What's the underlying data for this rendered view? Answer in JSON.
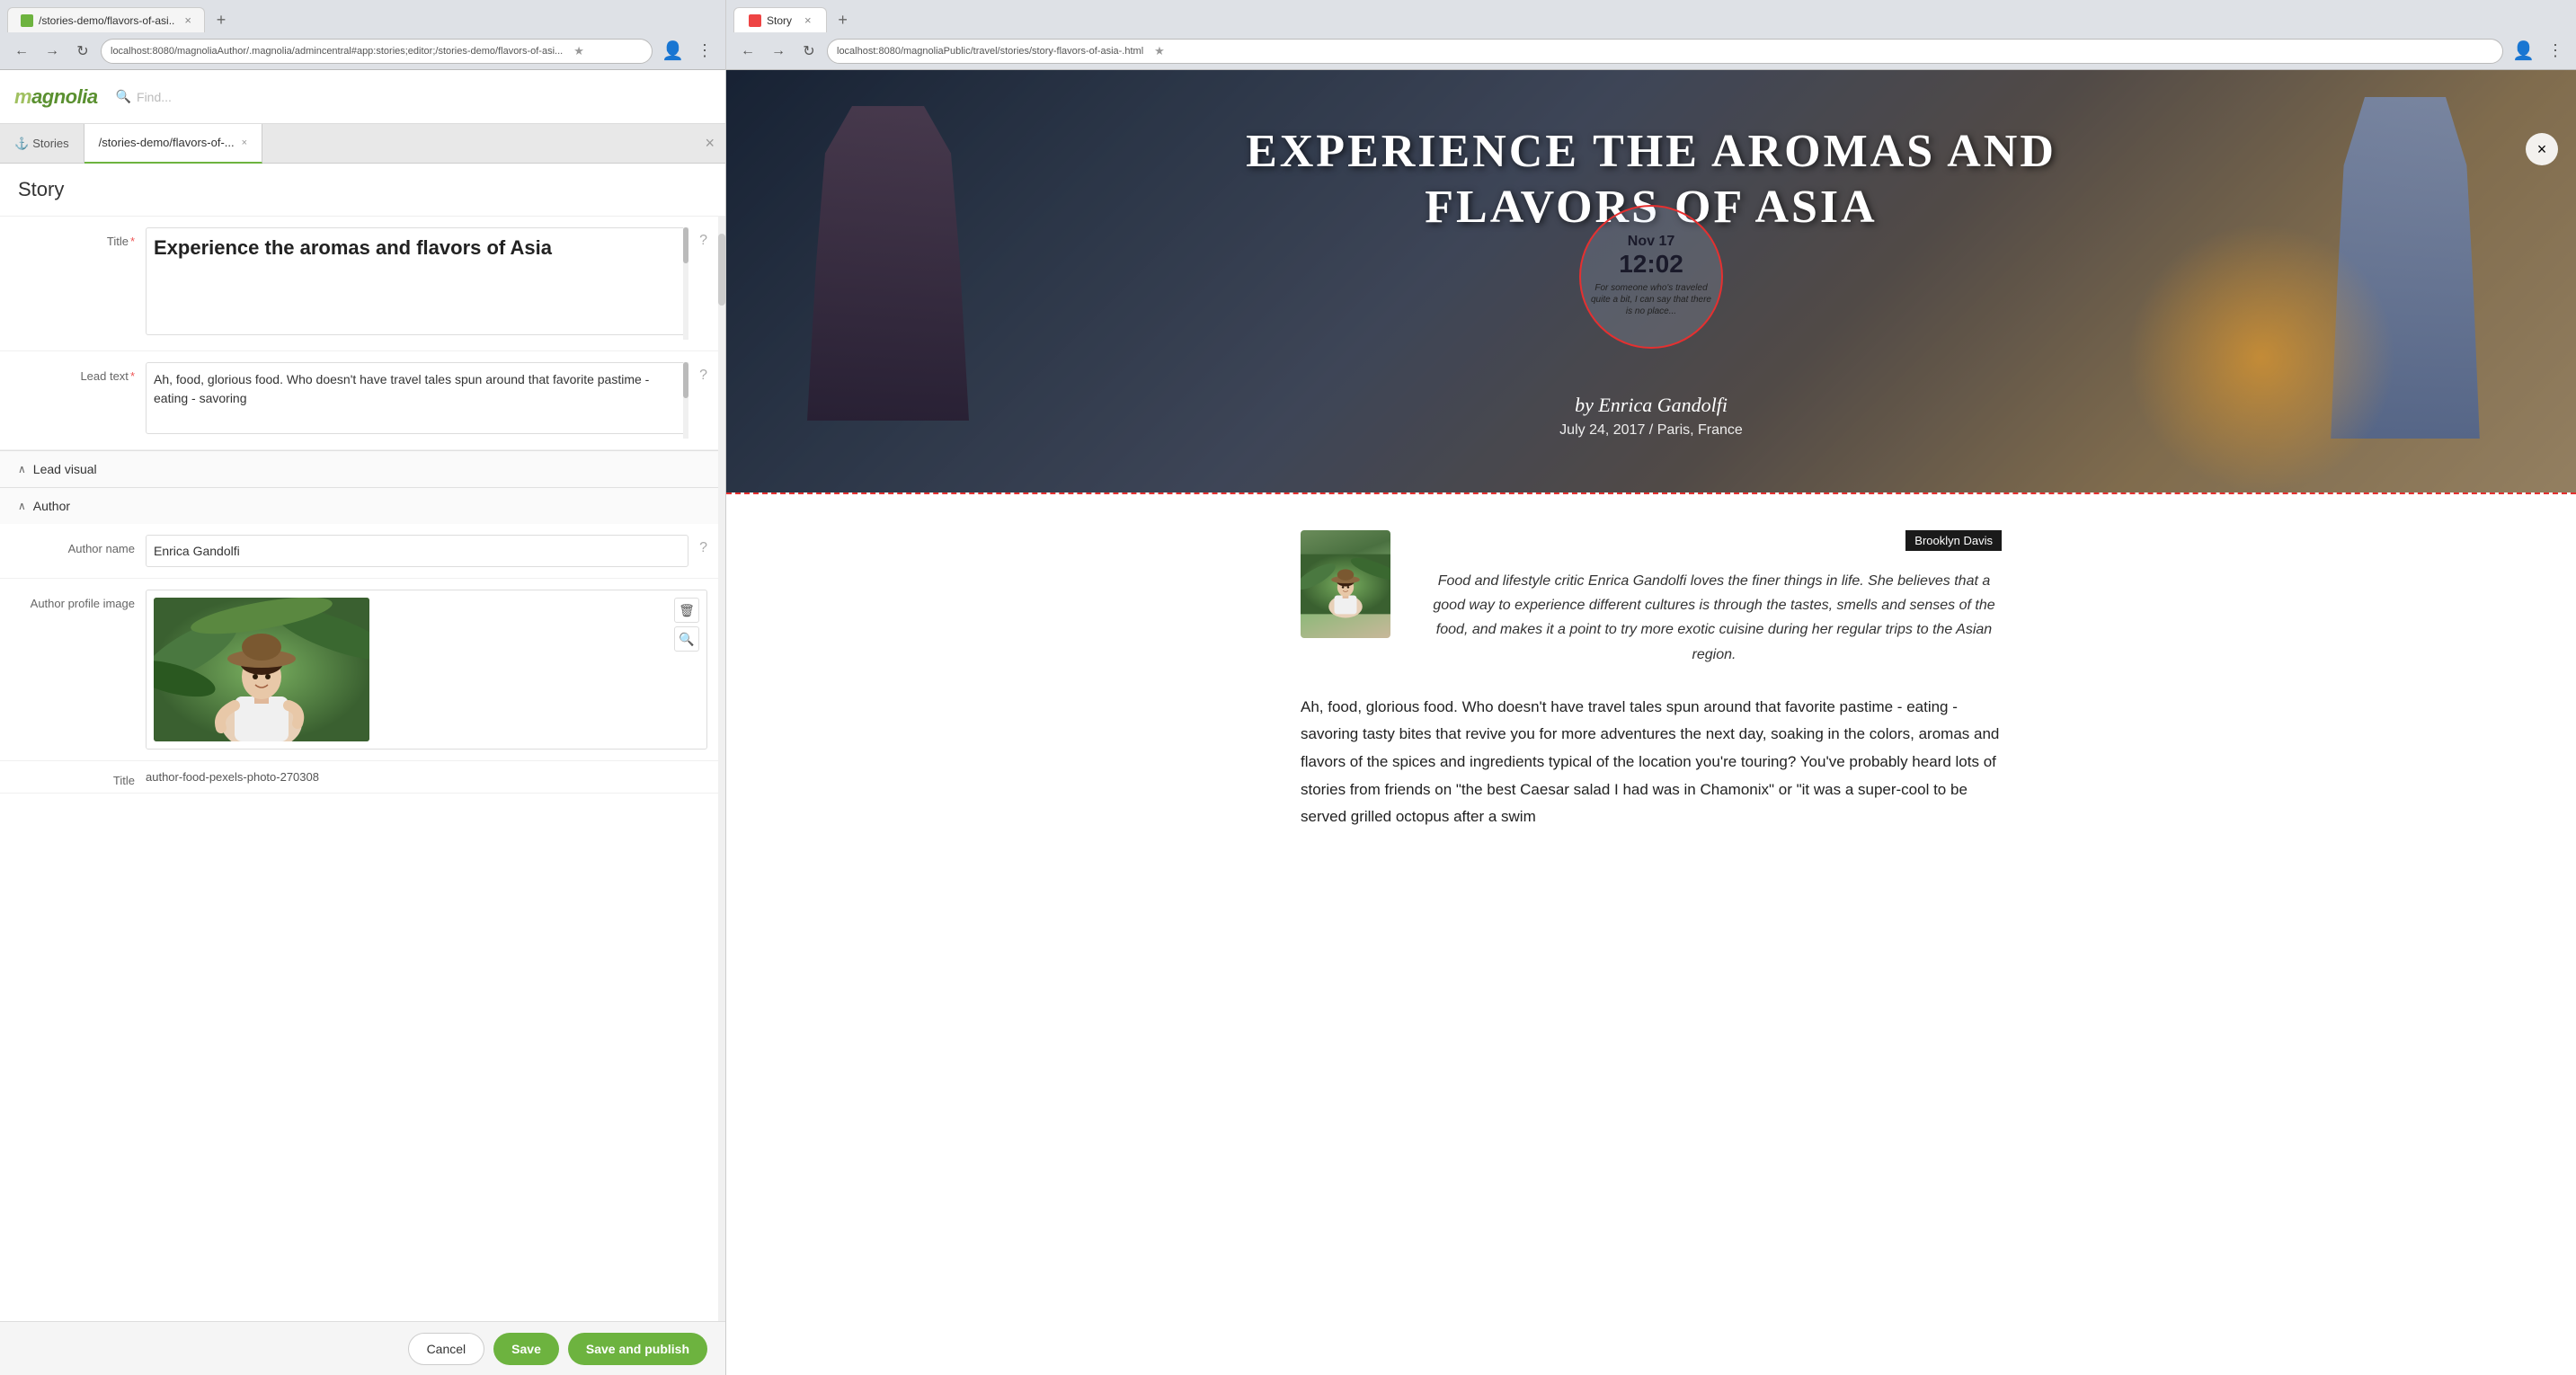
{
  "browser_left": {
    "tab_title": "/stories-demo/flavors-of-asi...",
    "url": "localhost:8080/magnoliaAuthor/.magnolia/admincentral#app:stories;editor;/stories-demo/flavors-of-asi...",
    "new_tab_btn": "+",
    "close_tab": "×"
  },
  "browser_right": {
    "tab_title": "Story",
    "url": "localhost:8080/magnoliaPublic/travel/stories/story-flavors-of-asia-.html",
    "new_tab_btn": "+",
    "close_tab": "×"
  },
  "magnolia": {
    "logo": "magnolia",
    "search_placeholder": "Find..."
  },
  "app_tabs": {
    "stories_label": "Stories",
    "active_tab_label": "/stories-demo/flavors-of-...",
    "active_tab_close": "×",
    "close_other": "×"
  },
  "form": {
    "section_title": "Story",
    "title_label": "Title",
    "title_required": "*",
    "title_value": "Experience the aromas and flavors of Asia",
    "lead_text_label": "Lead text",
    "lead_text_required": "*",
    "lead_text_value": "Ah, food, glorious food. Who doesn't have travel tales spun around that favorite pastime - eating - savoring",
    "lead_visual_label": "Lead visual",
    "lead_visual_arrow": "∧",
    "author_section_label": "Author",
    "author_section_arrow": "∧",
    "author_name_label": "Author name",
    "author_name_value": "Enrica Gandolfi",
    "author_profile_image_label": "Author profile image",
    "image_title_label": "Title",
    "image_title_value": "author-food-pexels-photo-270308",
    "help_icon": "?",
    "delete_icon": "🗑",
    "zoom_icon": "🔍"
  },
  "actions": {
    "cancel_label": "Cancel",
    "save_label": "Save",
    "save_publish_label": "Save and publish"
  },
  "preview": {
    "hero_title": "EXPERIENCE THE AROMAS AND FLAVORS OF ASIA",
    "hero_title_line1": "EXPERIENCE THE AROMAS AND",
    "hero_title_line2": "FLAVORS OF ASIA",
    "circle_date": "Nov 17",
    "circle_time": "12:02",
    "circle_text": "For someone who's traveled quite a bit, I can say that there is no place...",
    "by_author": "by Enrica Gandolfi",
    "date_location": "July 24, 2017 / Paris, France",
    "author_card_name": "Brooklyn Davis",
    "author_bio": "Food and lifestyle critic Enrica Gandolfi loves the finer things in life. She believes that a good way to experience different cultures is through the tastes, smells and senses of the food, and makes it a point to try more exotic cuisine during her regular trips to the Asian region.",
    "article_text": "Ah, food, glorious food. Who doesn't have travel tales spun around that favorite pastime - eating - savoring tasty bites that revive you for more adventures the next day, soaking in the colors, aromas and flavors of the spices and ingredients typical of the location you're touring? You've probably heard lots of stories from friends on \"the best Caesar salad I had was in Chamonix\" or \"it was a super-cool to be served grilled octopus after a swim",
    "close_icon": "×"
  }
}
